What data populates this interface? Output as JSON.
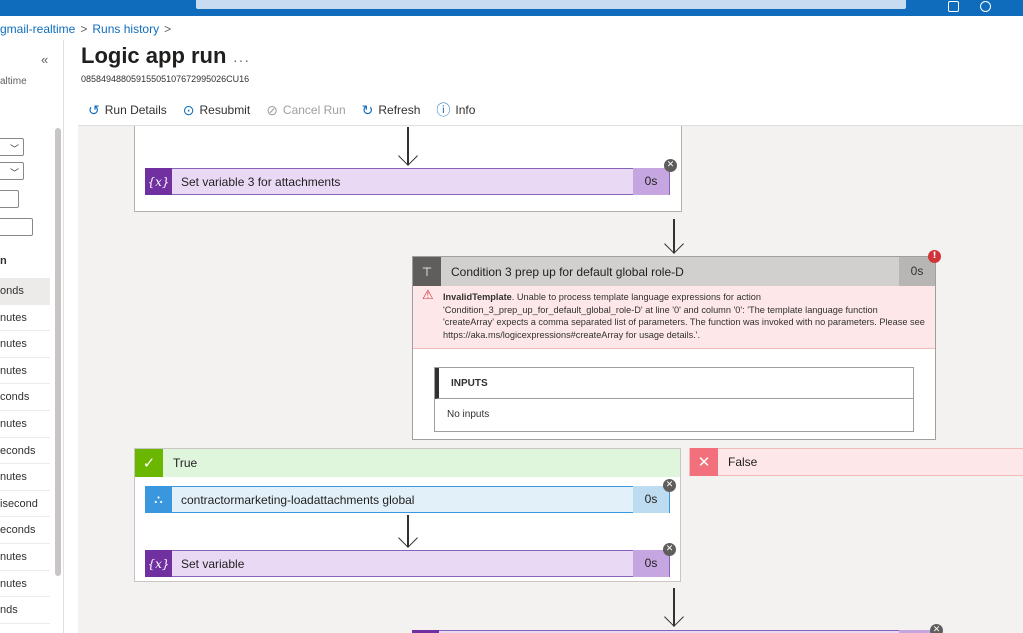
{
  "breadcrumb": {
    "item1": "gmail-realtime",
    "item2": "Runs history"
  },
  "left_pane": {
    "collapse_glyph": "«",
    "subtitle": "altime",
    "heading": "n",
    "rows": [
      "onds",
      "nutes",
      "nutes",
      "nutes",
      "conds",
      "nutes",
      "econds",
      "nutes",
      "isecond",
      "econds",
      "nutes",
      "nutes",
      "nds"
    ],
    "selected_row": 0
  },
  "page": {
    "title": "Logic app run",
    "more_glyph": "···",
    "run_id": "08584948805915505107672995026CU16"
  },
  "toolbar": {
    "run_details": "Run Details",
    "resubmit": "Resubmit",
    "cancel_run": "Cancel Run",
    "refresh": "Refresh",
    "info": "Info"
  },
  "canvas": {
    "set_var3": {
      "label": "Set variable 3 for attachments",
      "duration": "0s",
      "icon": "{x}"
    },
    "condition": {
      "label": "Condition 3 prep up for default global role-D",
      "duration": "0s",
      "error_title": "InvalidTemplate",
      "error_text": ". Unable to process template language expressions for action 'Condition_3_prep_up_for_default_global_role-D' at line '0' and column '0': 'The template language function 'createArray' expects a comma separated list of parameters. The function was invoked with no parameters. Please see https://aka.ms/logicexpressions#createArray for usage details.'.",
      "inputs_header": "INPUTS",
      "inputs_value": "No inputs"
    },
    "true_branch": {
      "label": "True",
      "icon": "✓"
    },
    "false_branch": {
      "label": "False",
      "icon": "✕"
    },
    "workflow": {
      "label": "contractormarketing-loadattachments global",
      "duration": "0s"
    },
    "set_var": {
      "label": "Set variable",
      "duration": "0s",
      "icon": "{x}"
    }
  }
}
